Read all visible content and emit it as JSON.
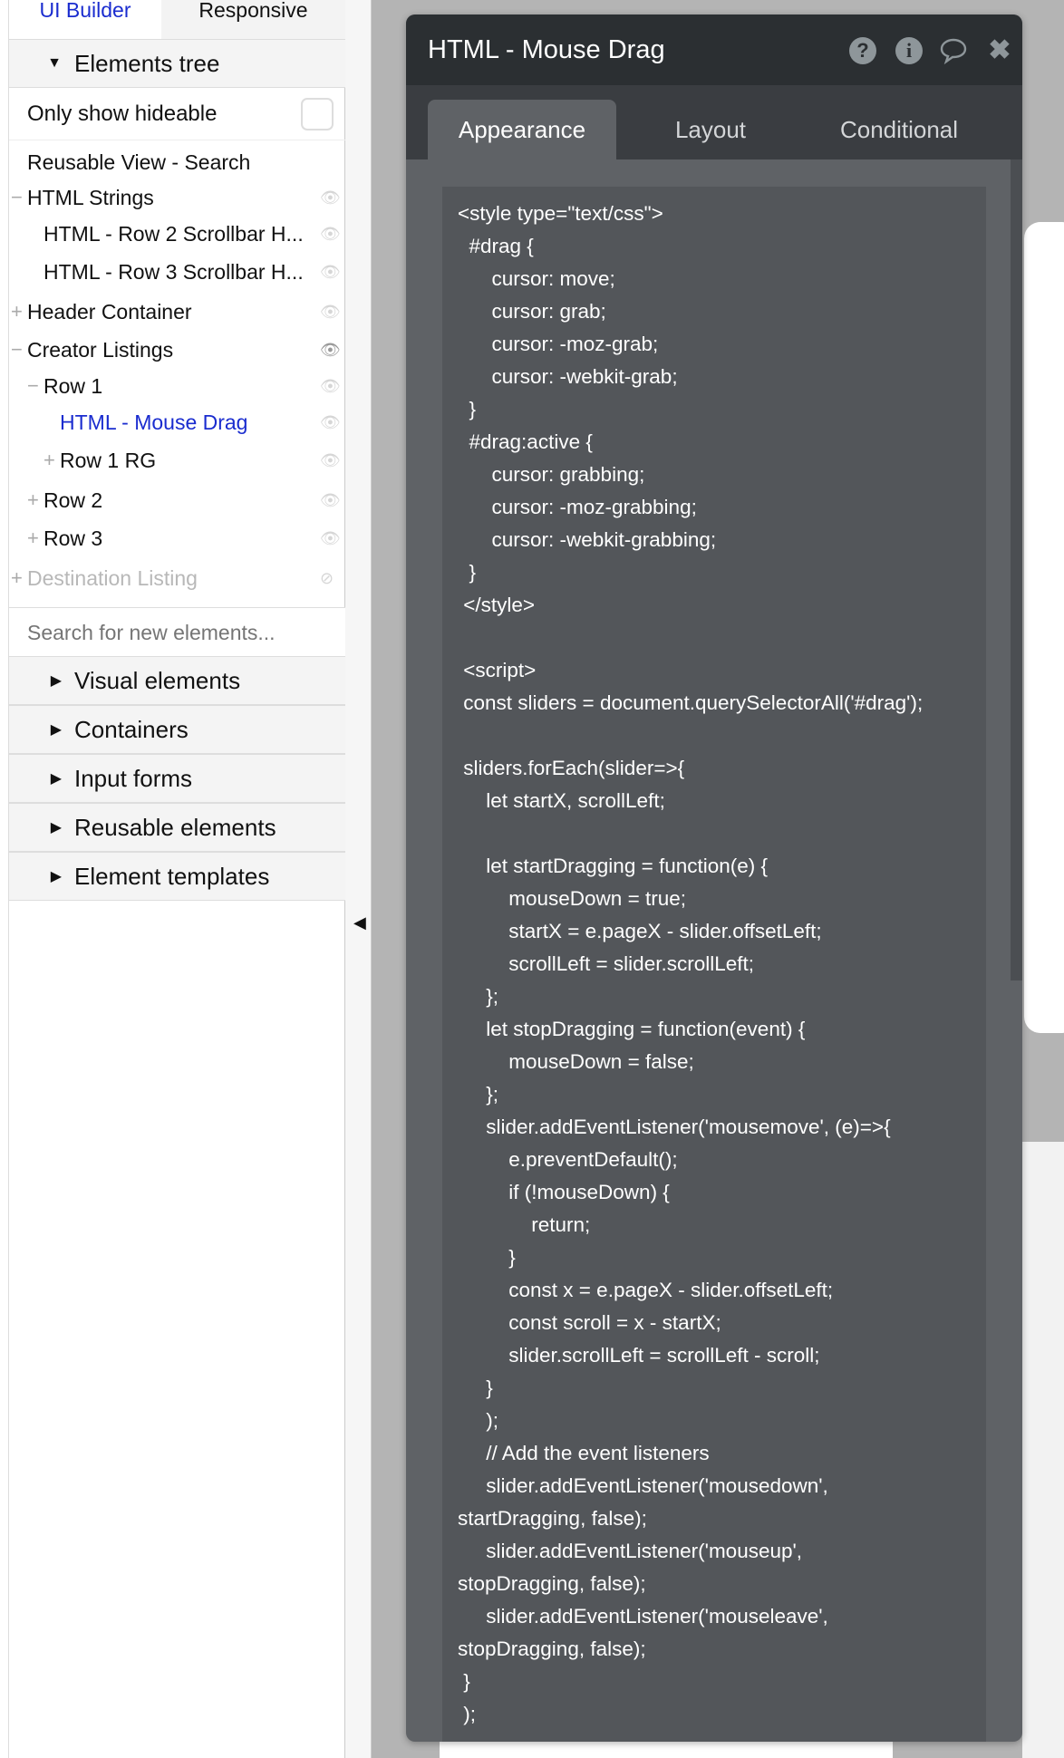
{
  "sidebar": {
    "tabs": {
      "ui_builder": "UI Builder",
      "responsive": "Responsive"
    },
    "elements_tree_label": "Elements tree",
    "only_show_hideable": "Only show hideable",
    "tree": [
      {
        "label": "Reusable View - Search",
        "level": 0,
        "toggle": "",
        "eye": ""
      },
      {
        "label": "HTML Strings",
        "level": 0,
        "toggle": "−",
        "eye": "👁"
      },
      {
        "label": "HTML - Row 2 Scrollbar H...",
        "level": 1,
        "toggle": "",
        "eye": "👁"
      },
      {
        "label": "HTML - Row 3 Scrollbar H...",
        "level": 1,
        "toggle": "",
        "eye": "👁"
      },
      {
        "label": "Header Container",
        "level": 0,
        "toggle": "+",
        "eye": "👁"
      },
      {
        "label": "Creator Listings",
        "level": 0,
        "toggle": "−",
        "eye": "👁"
      },
      {
        "label": "Row 1",
        "level": 1,
        "toggle": "−",
        "eye": "👁"
      },
      {
        "label": "HTML - Mouse Drag",
        "level": 2,
        "toggle": "",
        "eye": "👁",
        "selected": true
      },
      {
        "label": "Row 1 RG",
        "level": 2,
        "toggle": "+",
        "eye": "👁"
      },
      {
        "label": "Row 2",
        "level": 1,
        "toggle": "+",
        "eye": "👁"
      },
      {
        "label": "Row 3",
        "level": 1,
        "toggle": "+",
        "eye": "👁"
      },
      {
        "label": "Destination Listing",
        "level": 0,
        "toggle": "+",
        "eye": "⊘",
        "hidden": true
      }
    ],
    "search_placeholder": "Search for new elements...",
    "sections": [
      "Visual elements",
      "Containers",
      "Input forms",
      "Reusable elements",
      "Element templates"
    ]
  },
  "colors": {
    "selected": "#1a2ccf",
    "hidden": "#b8b8b8"
  },
  "modal": {
    "title": "HTML - Mouse Drag",
    "icons": [
      "help-icon",
      "info-icon",
      "comment-icon",
      "close-icon"
    ],
    "tabs": [
      "Appearance",
      "Layout",
      "Conditional"
    ],
    "active_tab": "Appearance",
    "code_lines": [
      "<style type=\"text/css\">",
      "  #drag {",
      "      cursor: move;",
      "      cursor: grab;",
      "      cursor: -moz-grab;",
      "      cursor: -webkit-grab;",
      "  }",
      "  #drag:active {",
      "      cursor: grabbing;",
      "      cursor: -moz-grabbing;",
      "      cursor: -webkit-grabbing;",
      "  }",
      " </style>",
      "",
      " <script>",
      " const sliders = document.querySelectorAll('#drag');",
      "",
      " sliders.forEach(slider=>{",
      "     let startX, scrollLeft;",
      "",
      "     let startDragging = function(e) {",
      "         mouseDown = true;",
      "         startX = e.pageX - slider.offsetLeft;",
      "         scrollLeft = slider.scrollLeft;",
      "     };",
      "     let stopDragging = function(event) {",
      "         mouseDown = false;",
      "     };",
      "     slider.addEventListener('mousemove', (e)=>{",
      "         e.preventDefault();",
      "         if (!mouseDown) {",
      "             return;",
      "         }",
      "         const x = e.pageX - slider.offsetLeft;",
      "         const scroll = x - startX;",
      "         slider.scrollLeft = scrollLeft - scroll;",
      "     }",
      "     );",
      "     // Add the event listeners",
      "     slider.addEventListener('mousedown',",
      "startDragging, false);",
      "     slider.addEventListener('mouseup',",
      "stopDragging, false);",
      "     slider.addEventListener('mouseleave',",
      "stopDragging, false);",
      " }",
      " );"
    ]
  }
}
